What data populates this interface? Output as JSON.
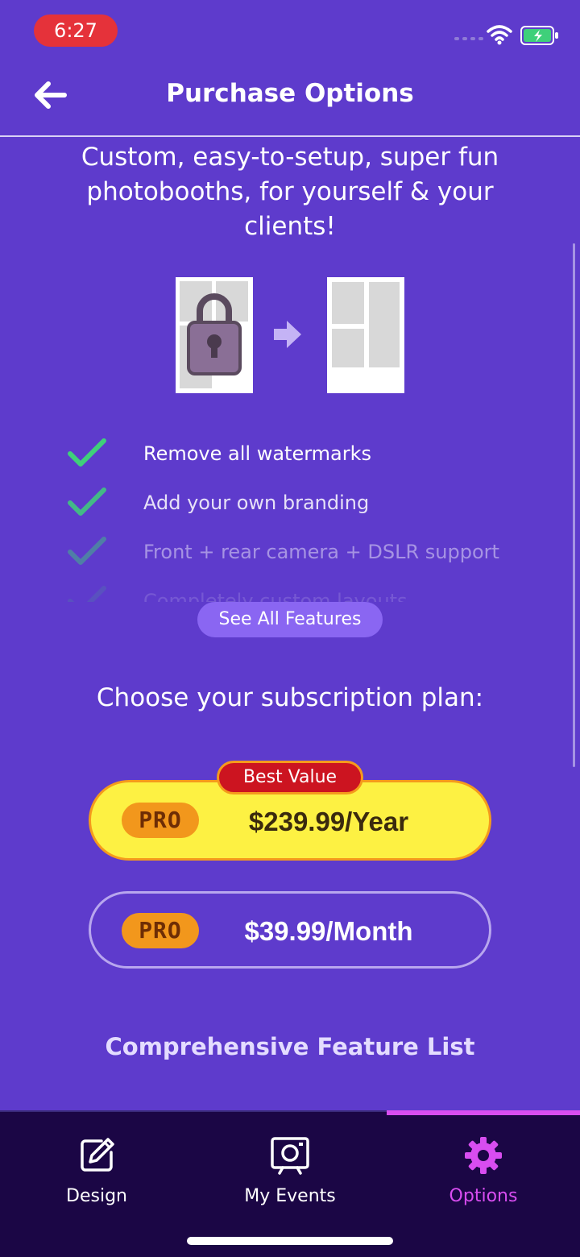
{
  "status_bar": {
    "time": "6:27",
    "icons": [
      "signal-icon",
      "wifi-icon",
      "battery-charging-icon"
    ]
  },
  "header": {
    "title": "Purchase Options",
    "back_icon": "arrow-left-icon"
  },
  "hero": {
    "tagline": "Custom, easy-to-setup, super fun photobooths, for yourself & your clients!"
  },
  "features": [
    {
      "label": "Remove all watermarks",
      "icon": "check-icon"
    },
    {
      "label": "Add your own branding",
      "icon": "check-icon"
    },
    {
      "label": "Front + rear camera + DSLR support",
      "icon": "check-icon"
    },
    {
      "label": "Completely custom layouts",
      "icon": "check-icon"
    }
  ],
  "see_all_label": "See All Features",
  "subscription": {
    "heading": "Choose your subscription plan:",
    "best_value_label": "Best Value",
    "plans": [
      {
        "badge": "PRO",
        "price": "$239.99/Year",
        "highlighted": true
      },
      {
        "badge": "PRO",
        "price": "$39.99/Month",
        "highlighted": false
      }
    ]
  },
  "feature_list_link": "Comprehensive Feature List",
  "tabs": [
    {
      "label": "Design",
      "icon": "pencil-edit-icon",
      "active": false
    },
    {
      "label": "My Events",
      "icon": "photo-frame-icon",
      "active": false
    },
    {
      "label": "Options",
      "icon": "gear-icon",
      "active": true
    }
  ],
  "colors": {
    "background": "#5e3bcc",
    "accent": "#d84df0",
    "best_value_plan": "#fdf143",
    "pro_badge": "#f2971c",
    "best_value_badge": "#cc1420",
    "check": "#3fd07a",
    "tab_bar": "#1b0645"
  }
}
